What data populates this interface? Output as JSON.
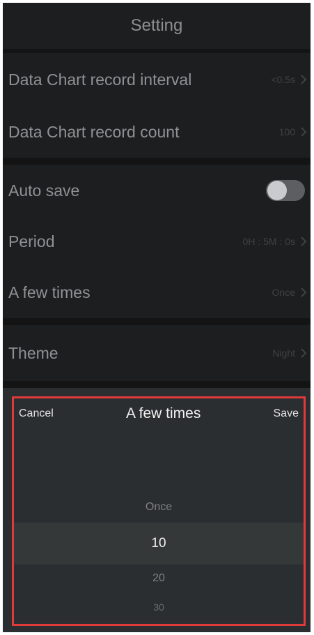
{
  "header": {
    "title": "Setting"
  },
  "chart_settings": {
    "record_interval": {
      "label": "Data Chart record interval",
      "value": "<0.5s"
    },
    "record_count": {
      "label": "Data Chart record count",
      "value": "100"
    }
  },
  "save_settings": {
    "auto_save": {
      "label": "Auto save",
      "enabled": false
    },
    "period": {
      "label": "Period",
      "value": "0H : 5M : 0s"
    },
    "times": {
      "label": "A few times",
      "value": "Once"
    }
  },
  "display_settings": {
    "theme": {
      "label": "Theme",
      "value": "Night"
    }
  },
  "picker_sheet": {
    "cancel_label": "Cancel",
    "title": "A few times",
    "save_label": "Save",
    "options": [
      "Once",
      "10",
      "20",
      "30"
    ],
    "selected": "10",
    "highlight_color": "#e03a3a"
  },
  "icons": {
    "chevron": "chevron-right-icon"
  }
}
